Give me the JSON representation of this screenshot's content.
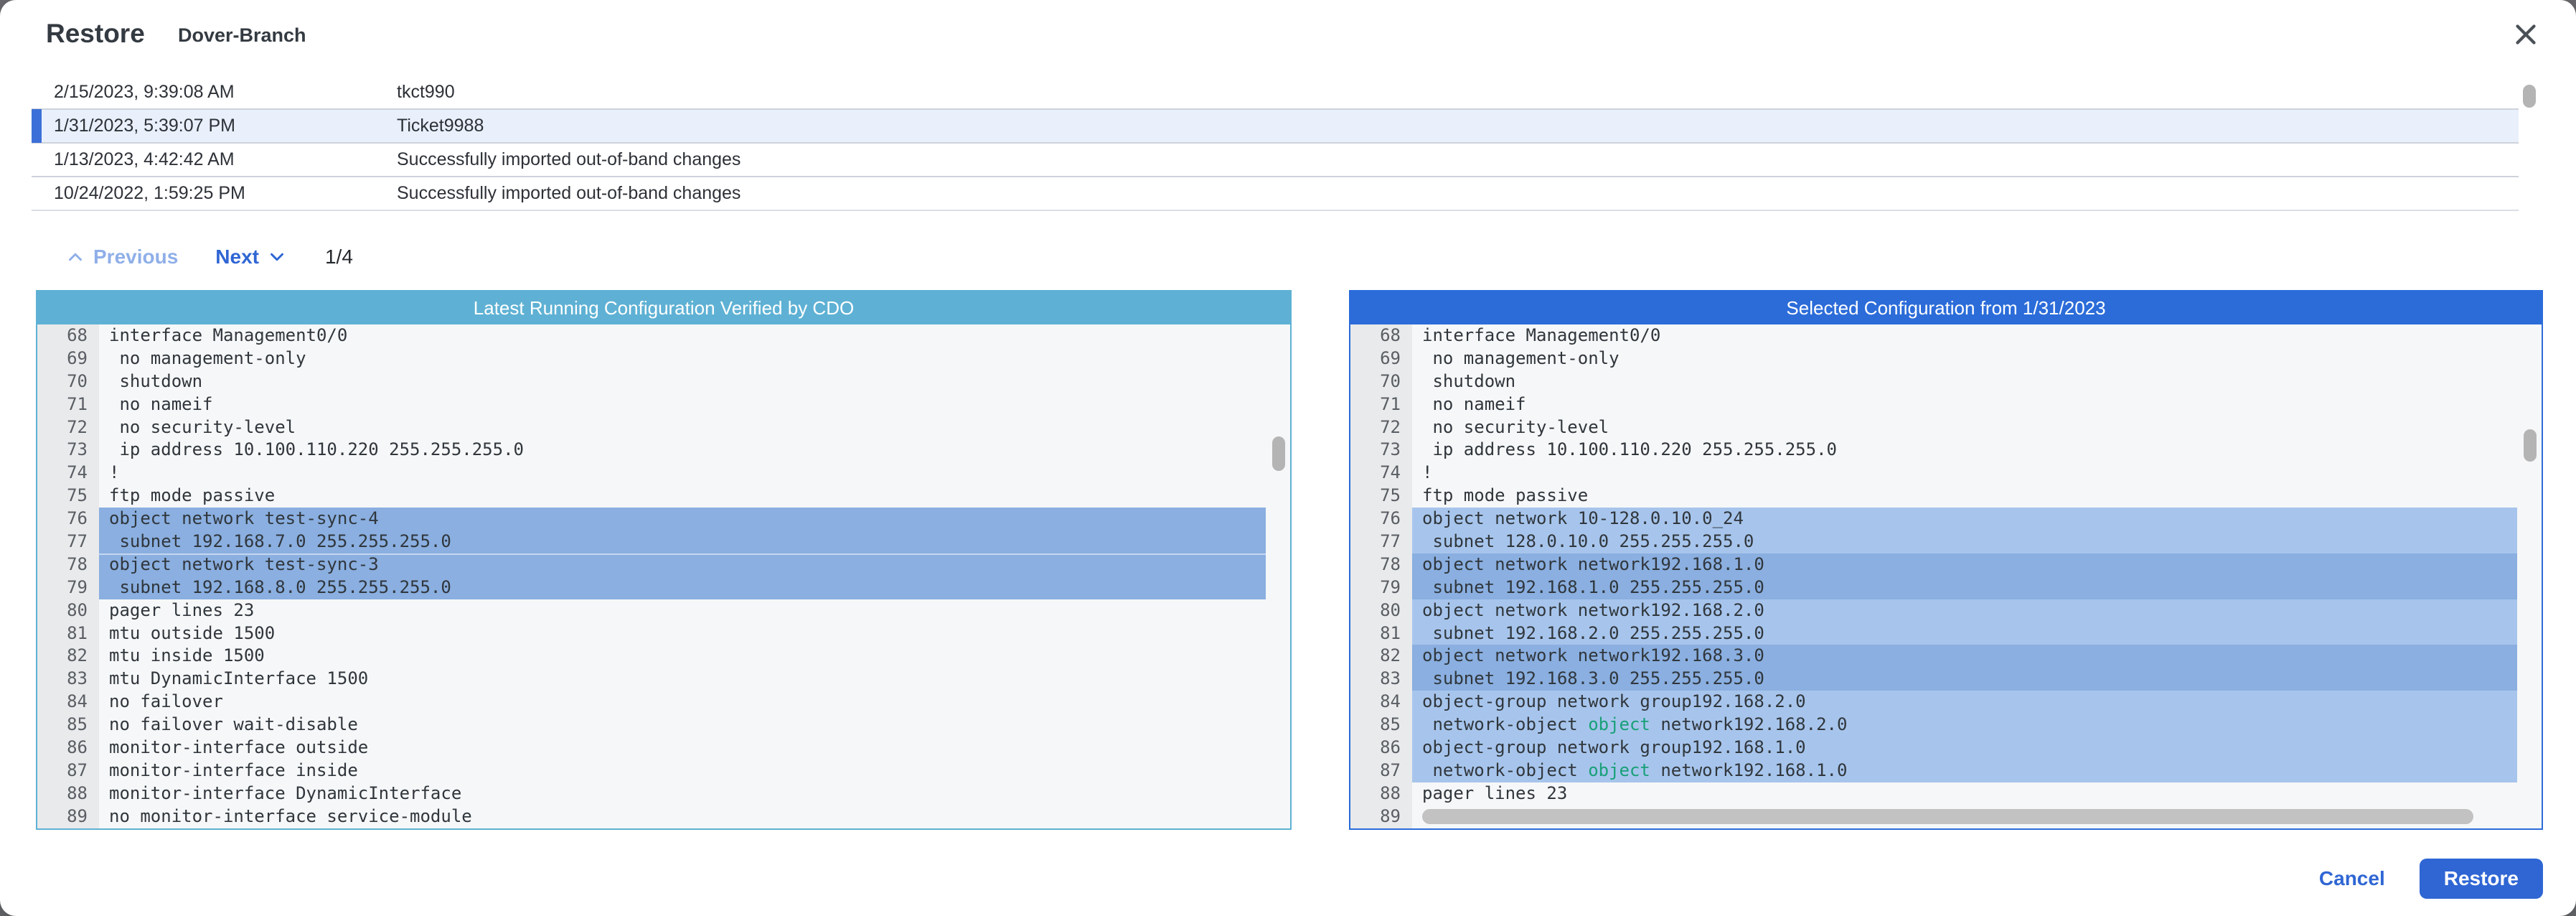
{
  "dialog": {
    "title": "Restore",
    "device": "Dover-Branch"
  },
  "history": {
    "rows": [
      {
        "timestamp": "2/15/2023, 9:39:08 AM",
        "description": "tkct990",
        "selected": false
      },
      {
        "timestamp": "1/31/2023, 5:39:07 PM",
        "description": "Ticket9988",
        "selected": true
      },
      {
        "timestamp": "1/13/2023, 4:42:42 AM",
        "description": "Successfully imported out-of-band changes",
        "selected": false
      },
      {
        "timestamp": "10/24/2022, 1:59:25 PM",
        "description": "Successfully imported out-of-band changes",
        "selected": false
      }
    ]
  },
  "pagination": {
    "previous_label": "Previous",
    "next_label": "Next",
    "page_indicator": "1/4"
  },
  "panels": {
    "left": {
      "header": "Latest Running Configuration Verified by CDO",
      "lines": [
        {
          "n": 68,
          "text": "interface Management0/0"
        },
        {
          "n": 69,
          "text": " no management-only"
        },
        {
          "n": 70,
          "text": " shutdown"
        },
        {
          "n": 71,
          "text": " no nameif"
        },
        {
          "n": 72,
          "text": " no security-level"
        },
        {
          "n": 73,
          "text": " ip address 10.100.110.220 255.255.255.0"
        },
        {
          "n": 74,
          "text": "!"
        },
        {
          "n": 75,
          "text": "ftp mode passive"
        },
        {
          "n": 76,
          "text": "object network test-sync-4",
          "hl": "dark"
        },
        {
          "n": 77,
          "text": " subnet 192.168.7.0 255.255.255.0",
          "hl": "dark"
        },
        {
          "n": 78,
          "text": "object network test-sync-3",
          "hl": "dark",
          "sep": true
        },
        {
          "n": 79,
          "text": " subnet 192.168.8.0 255.255.255.0",
          "hl": "dark"
        },
        {
          "n": 80,
          "text": "pager lines 23"
        },
        {
          "n": 81,
          "text": "mtu outside 1500"
        },
        {
          "n": 82,
          "text": "mtu inside 1500"
        },
        {
          "n": 83,
          "text": "mtu DynamicInterface 1500"
        },
        {
          "n": 84,
          "text": "no failover"
        },
        {
          "n": 85,
          "text": "no failover wait-disable"
        },
        {
          "n": 86,
          "text": "monitor-interface outside"
        },
        {
          "n": 87,
          "text": "monitor-interface inside"
        },
        {
          "n": 88,
          "text": "monitor-interface DynamicInterface"
        },
        {
          "n": 89,
          "text": "no monitor-interface service-module"
        }
      ]
    },
    "right": {
      "header": "Selected Configuration from 1/31/2023",
      "lines": [
        {
          "n": 68,
          "text": "interface Management0/0"
        },
        {
          "n": 69,
          "text": " no management-only"
        },
        {
          "n": 70,
          "text": " shutdown"
        },
        {
          "n": 71,
          "text": " no nameif"
        },
        {
          "n": 72,
          "text": " no security-level"
        },
        {
          "n": 73,
          "text": " ip address 10.100.110.220 255.255.255.0"
        },
        {
          "n": 74,
          "text": "!"
        },
        {
          "n": 75,
          "text": "ftp mode passive"
        },
        {
          "n": 76,
          "text": "object network 10-128.0.10.0_24",
          "hl": "light"
        },
        {
          "n": 77,
          "text": " subnet 128.0.10.0 255.255.255.0",
          "hl": "light"
        },
        {
          "n": 78,
          "text": "object network network192.168.1.0",
          "hl": "dark"
        },
        {
          "n": 79,
          "text": " subnet 192.168.1.0 255.255.255.0",
          "hl": "dark"
        },
        {
          "n": 80,
          "text": "object network network192.168.2.0",
          "hl": "light"
        },
        {
          "n": 81,
          "text": " subnet 192.168.2.0 255.255.255.0",
          "hl": "light"
        },
        {
          "n": 82,
          "text": "object network network192.168.3.0",
          "hl": "dark"
        },
        {
          "n": 83,
          "text": " subnet 192.168.3.0 255.255.255.0",
          "hl": "dark"
        },
        {
          "n": 84,
          "text": "object-group network group192.168.2.0",
          "hl": "light"
        },
        {
          "n": 85,
          "hl": "light",
          "parts": [
            {
              "t": " network-object "
            },
            {
              "t": "object",
              "c": "kw"
            },
            {
              "t": " network192.168.2.0"
            }
          ]
        },
        {
          "n": 86,
          "text": "object-group network group192.168.1.0",
          "hl": "light"
        },
        {
          "n": 87,
          "hl": "light",
          "parts": [
            {
              "t": " network-object "
            },
            {
              "t": "object",
              "c": "kw"
            },
            {
              "t": " network192.168.1.0"
            }
          ]
        },
        {
          "n": 88,
          "text": "pager lines 23"
        },
        {
          "n": 89,
          "text": "",
          "h_scrollbar": true
        }
      ]
    }
  },
  "footer": {
    "cancel_label": "Cancel",
    "restore_label": "Restore"
  },
  "colors": {
    "primary_blue": "#2F66D4",
    "left_panel_header": "#5EB1D4",
    "right_panel_header": "#2B6CD9",
    "diff_dark": "#8AAFE0",
    "diff_light": "#A7C5EC",
    "keyword_teal": "#18A078",
    "selected_row_bg": "#E9F0FC",
    "selected_row_accent": "#3C70D8",
    "muted_link": "#8FAFE8",
    "code_text": "#30363C"
  }
}
